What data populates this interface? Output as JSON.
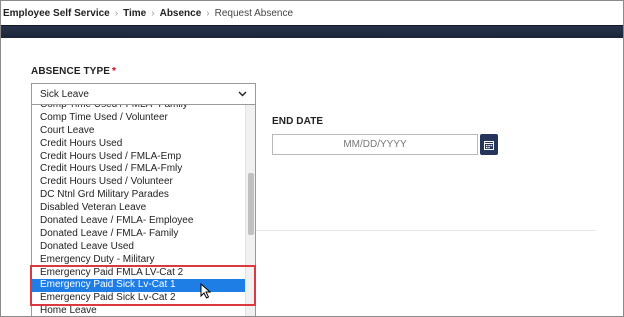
{
  "breadcrumb": [
    {
      "label": "Employee Self Service",
      "style": "bold"
    },
    {
      "label": "Time",
      "style": "bold"
    },
    {
      "label": "Absence",
      "style": "bold"
    },
    {
      "label": "Request Absence",
      "style": "current"
    }
  ],
  "absence_type": {
    "label": "ABSENCE TYPE",
    "required_mark": "*",
    "selected_value": "Sick Leave",
    "options": [
      "Comp Time Used / FMLA- Family",
      "Comp Time Used / Volunteer",
      "Court Leave",
      "Credit Hours Used",
      "Credit Hours Used / FMLA-Emp",
      "Credit Hours Used / FMLA-Fmly",
      "Credit Hours Used / Volunteer",
      "DC Ntnl Grd Military Parades",
      "Disabled Veteran Leave",
      "Donated Leave / FMLA- Employee",
      "Donated Leave / FMLA- Family",
      "Donated Leave Used",
      "Emergency Duty - Military",
      "Emergency Paid FMLA LV-Cat 2",
      "Emergency Paid Sick Lv-Cat 1",
      "Emergency Paid Sick Lv-Cat 2",
      "Home Leave"
    ],
    "highlighted_option": "Emergency Paid Sick Lv-Cat 1",
    "scroll_position": 0.45
  },
  "end_date": {
    "label": "END DATE",
    "placeholder": "MM/DD/YYYY",
    "calendar_icon": "calendar-icon"
  },
  "colors": {
    "banner": "#1f2940",
    "selected_option": "#1e7ee6",
    "annotation_box": "#d9393f",
    "required_mark": "#d0021b",
    "calendar_button": "#24345a"
  }
}
